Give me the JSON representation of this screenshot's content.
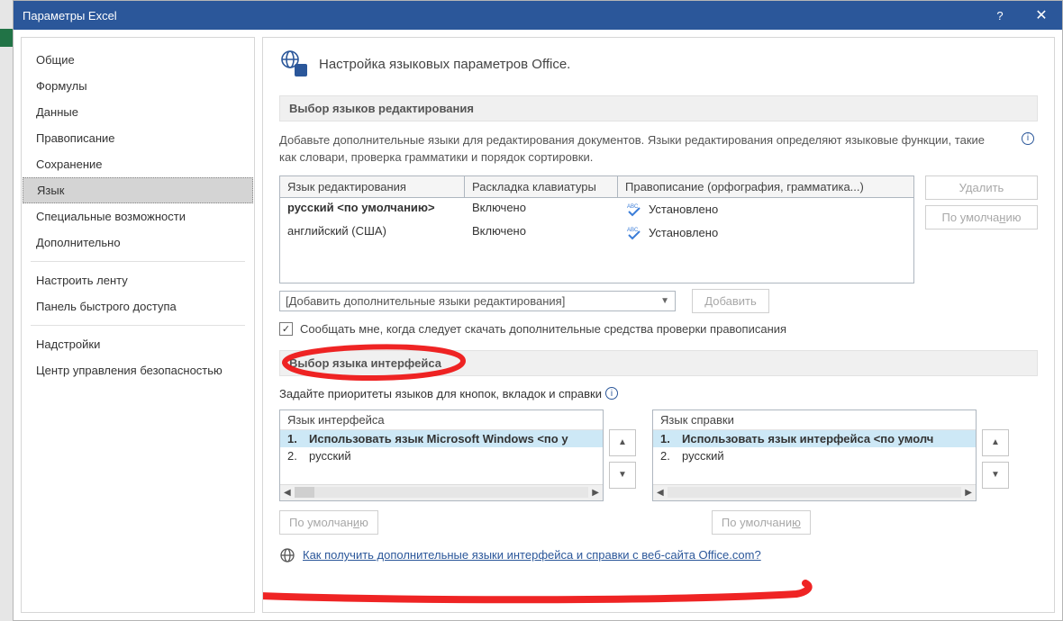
{
  "title": "Параметры Excel",
  "sidebar": {
    "items": [
      "Общие",
      "Формулы",
      "Данные",
      "Правописание",
      "Сохранение",
      "Язык",
      "Специальные возможности",
      "Дополнительно",
      "Настроить ленту",
      "Панель быстрого доступа",
      "Надстройки",
      "Центр управления безопасностью"
    ],
    "selected": 5
  },
  "content": {
    "heading": "Настройка языковых параметров Office.",
    "section1": "Выбор языков редактирования",
    "desc1": "Добавьте дополнительные языки для редактирования документов. Языки редактирования определяют языковые функции, такие как словари, проверка грамматики и порядок сортировки.",
    "table": {
      "cols": [
        "Язык редактирования",
        "Раскладка клавиатуры",
        "Правописание (орфография, грамматика...)"
      ],
      "rows": [
        {
          "lang": "русский <по умолчанию>",
          "kb": "Включено",
          "spell": "Установлено",
          "bold": true
        },
        {
          "lang": "английский (США)",
          "kb": "Включено",
          "spell": "Установлено",
          "bold": false
        }
      ]
    },
    "btn_delete_pre": "У",
    "btn_delete_accel": "д",
    "btn_delete_post": "алить",
    "btn_default_pre": "По умолча",
    "btn_default_accel": "н",
    "btn_default_post": "ию",
    "combo": "[Добавить дополнительные языки редактирования]",
    "btn_add_pre": "",
    "btn_add_accel": "Д",
    "btn_add_post": "обавить",
    "check": "Сообщать мне, когда следует скачать дополнительные средства проверки правописания",
    "section2": "Выбор языка интерфейса",
    "desc2": "Задайте приоритеты языков для кнопок, вкладок и справки",
    "display": {
      "header": "Язык интерфейса",
      "items": [
        {
          "n": "1.",
          "t": "Использовать язык Microsoft Windows <по у",
          "sel": true
        },
        {
          "n": "2.",
          "t": "русский",
          "sel": false
        }
      ]
    },
    "help": {
      "header": "Язык справки",
      "items": [
        {
          "n": "1.",
          "t": "Использовать язык интерфейса <по умолч",
          "sel": true
        },
        {
          "n": "2.",
          "t": "русский",
          "sel": false
        }
      ]
    },
    "btn_setdefault_pre": "По умолчан",
    "btn_setdefault_accel": "и",
    "btn_setdefault_post": "ю",
    "btn_setdefault2_pre": "По умолчани",
    "btn_setdefault2_accel": "ю",
    "btn_setdefault2_post": "",
    "link": "Как получить дополнительные языки интерфейса и справки с веб-сайта Office.com?"
  }
}
